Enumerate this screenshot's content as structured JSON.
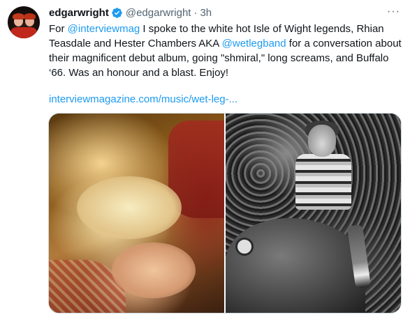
{
  "tweet": {
    "display_name": "edgarwright",
    "handle": "@edgarwright",
    "separator": "·",
    "time": "3h",
    "more_label": "···",
    "text": {
      "p1": "For ",
      "mention1": "@interviewmag",
      "p2": " I spoke to the white hot Isle of Wight legends, Rhian Teasdale and Hester Chambers AKA ",
      "mention2": "@wetlegband",
      "p3": " for a conversation about their magnificent debut album, going \"shmiral,\" long screams, and Buffalo ‘66. Was an honour and a blast. Enjoy!"
    },
    "link": "interviewmagazine.com/music/wet-leg-...",
    "colors": {
      "accent": "#1d9bf0",
      "text": "#0f1419",
      "secondary": "#536471",
      "verified": "#1d9bf0"
    },
    "icons": {
      "verified": "verified-badge-icon",
      "more": "more-horizontal-icon"
    }
  }
}
